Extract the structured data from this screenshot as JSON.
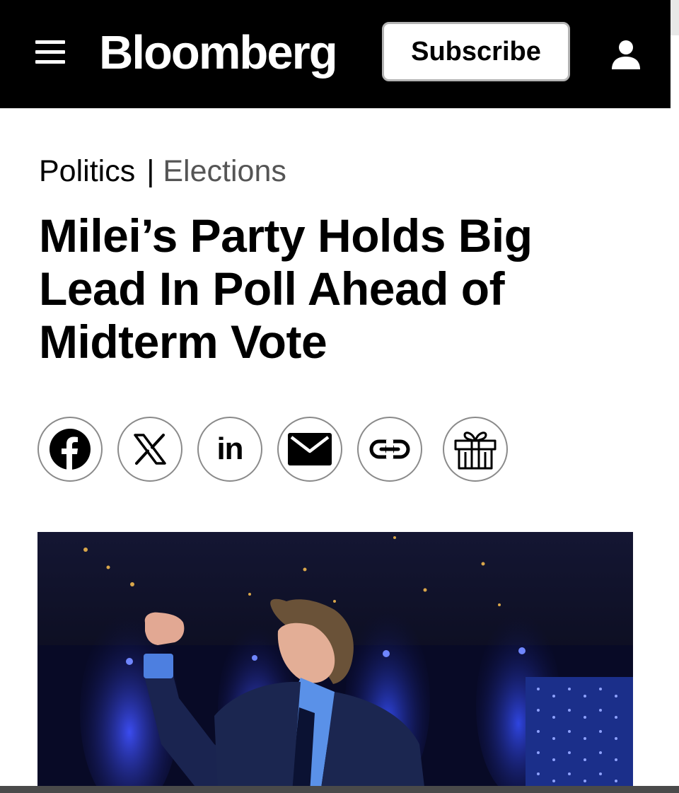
{
  "header": {
    "logo": "Bloomberg",
    "subscribe_label": "Subscribe",
    "menu_icon": "hamburger-menu-icon",
    "account_icon": "user-account-icon"
  },
  "article": {
    "breadcrumb": {
      "section": "Politics",
      "separator": "|",
      "subsection": "Elections"
    },
    "headline": "Milei’s Party Holds Big Lead In Poll Ahead of Midterm Vote"
  },
  "share": {
    "buttons": [
      {
        "icon": "facebook-icon"
      },
      {
        "icon": "x-icon"
      },
      {
        "icon": "linkedin-icon",
        "text": "in"
      },
      {
        "icon": "email-icon"
      },
      {
        "icon": "link-icon"
      },
      {
        "icon": "gift-icon"
      }
    ]
  },
  "colors": {
    "header_bg": "#000000",
    "hero_bg": "#0a0c25",
    "accent_blue": "#2a3bd6"
  }
}
